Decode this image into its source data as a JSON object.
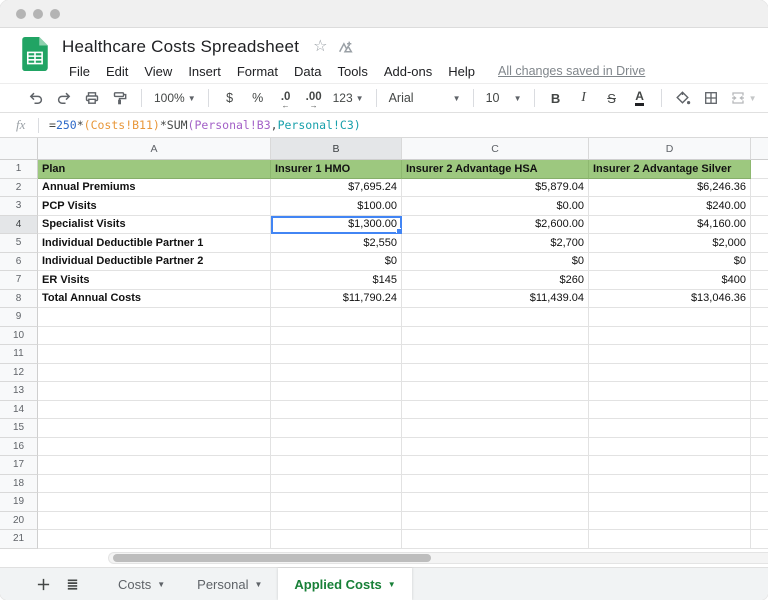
{
  "header": {
    "title": "Healthcare Costs Spreadsheet",
    "menu_items": [
      "File",
      "Edit",
      "View",
      "Insert",
      "Format",
      "Data",
      "Tools",
      "Add-ons",
      "Help"
    ],
    "save_status": "All changes saved in Drive"
  },
  "toolbar": {
    "zoom_value": "100%",
    "currency_label": "$",
    "percent_label": "%",
    "decrease_decimal_label": ".0",
    "increase_decimal_label": ".00",
    "number_format_label": "123",
    "font_name": "Arial",
    "font_size": "10",
    "bold_label": "B",
    "italic_label": "I",
    "strikethrough_label": "S",
    "text_color_label": "A"
  },
  "formula_bar": {
    "fx_label": "fx",
    "formula_segments": [
      {
        "text": "=",
        "color": "#444746"
      },
      {
        "text": "250",
        "color": "#2c68c8"
      },
      {
        "text": "*",
        "color": "#444746"
      },
      {
        "text": "(Costs!B11)",
        "color": "#e8973a"
      },
      {
        "text": "*",
        "color": "#444746"
      },
      {
        "text": "SUM",
        "color": "#444746"
      },
      {
        "text": "(Personal!B3",
        "color": "#a361c7"
      },
      {
        "text": ",",
        "color": "#444746"
      },
      {
        "text": "Personal!C3)",
        "color": "#18a0ab"
      }
    ]
  },
  "grid": {
    "column_letters": [
      "A",
      "B",
      "C",
      "D"
    ],
    "row_count": 21,
    "selection": {
      "cell": "B4",
      "column": "B",
      "row": 4
    },
    "data_rows": [
      [
        "Plan",
        "Insurer 1 HMO",
        "Insurer 2 Advantage HSA",
        "Insurer 2 Advantage Silver"
      ],
      [
        "Annual Premiums",
        "$7,695.24",
        "$5,879.04",
        "$6,246.36"
      ],
      [
        "PCP Visits",
        "$100.00",
        "$0.00",
        "$240.00"
      ],
      [
        "Specialist Visits",
        "$1,300.00",
        "$2,600.00",
        "$4,160.00"
      ],
      [
        "Individual Deductible Partner 1",
        "$2,550",
        "$2,700",
        "$2,000"
      ],
      [
        "Individual Deductible Partner 2",
        "$0",
        "$0",
        "$0"
      ],
      [
        "ER Visits",
        "$145",
        "$260",
        "$400"
      ],
      [
        "Total Annual Costs",
        "$11,790.24",
        "$11,439.04",
        "$13,046.36"
      ]
    ]
  },
  "sheet_tabs": {
    "tabs": [
      {
        "label": "Costs",
        "active": false
      },
      {
        "label": "Personal",
        "active": false
      },
      {
        "label": "Applied Costs",
        "active": true
      }
    ]
  },
  "colors": {
    "header_row_bg": "#9dc87f",
    "selection_blue": "#4285f4",
    "active_tab_green": "#188038",
    "logo_green": "#21a464"
  }
}
